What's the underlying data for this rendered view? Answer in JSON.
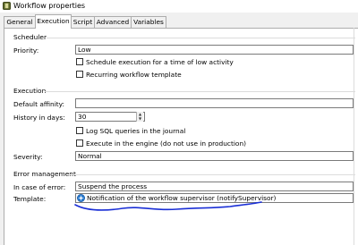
{
  "window": {
    "title": "Workflow properties"
  },
  "tabs": [
    {
      "label": "General"
    },
    {
      "label": "Execution"
    },
    {
      "label": "Script"
    },
    {
      "label": "Advanced"
    },
    {
      "label": "Variables"
    }
  ],
  "active_tab": "Execution",
  "scheduler": {
    "heading": "Scheduler",
    "priority_label": "Priority:",
    "priority_value": "Low",
    "schedule_option": "Schedule execution for a time of low activity",
    "schedule_checked": false,
    "recurring_option": "Recurring workflow template",
    "recurring_checked": false
  },
  "execution": {
    "heading": "Execution",
    "affinity_label": "Default affinity:",
    "affinity_value": "",
    "history_label": "History in days:",
    "history_value": "30",
    "log_sql_option": "Log SQL queries in the journal",
    "log_sql_checked": false,
    "engine_option": "Execute in the engine (do not use in production)",
    "engine_checked": false,
    "severity_label": "Severity:",
    "severity_value": "Normal"
  },
  "error_management": {
    "heading": "Error management",
    "in_case_label": "In case of error:",
    "in_case_value": "Suspend the process",
    "template_label": "Template:",
    "template_value": "Notification of the workflow supervisor (notifySupervisor)"
  },
  "colors": {
    "annotation_underline": "#1a2fd6",
    "template_icon": "#2d7fd3"
  }
}
